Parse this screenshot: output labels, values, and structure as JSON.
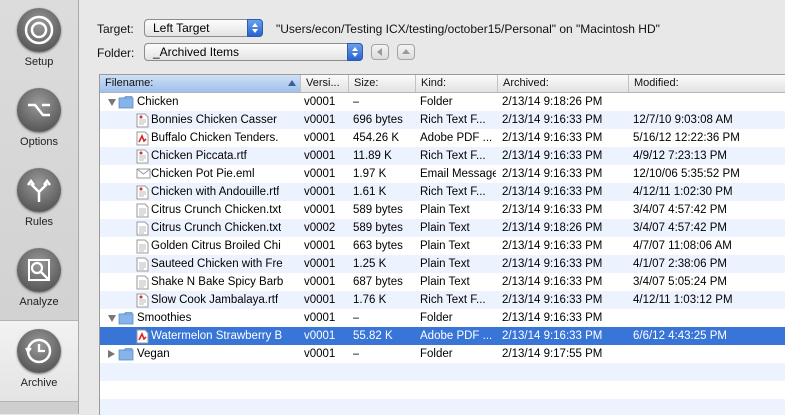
{
  "sidebar": {
    "items": [
      {
        "label": "Setup",
        "icon": "setup-icon"
      },
      {
        "label": "Options",
        "icon": "options-icon"
      },
      {
        "label": "Rules",
        "icon": "rules-icon"
      },
      {
        "label": "Analyze",
        "icon": "analyze-icon"
      },
      {
        "label": "Archive",
        "icon": "archive-icon",
        "selected": true
      }
    ]
  },
  "target": {
    "label": "Target:",
    "value": "Left Target",
    "path": "\"Users/econ/Testing ICX/testing/october15/Personal\" on \"Macintosh HD\""
  },
  "folder": {
    "label": "Folder:",
    "value": "_Archived Items"
  },
  "table": {
    "columns": [
      "Filename:",
      "Versi...",
      "Size:",
      "Kind:",
      "Archived:",
      "Modified:"
    ],
    "rows": [
      {
        "type": "folder",
        "open": true,
        "indent": 0,
        "name": "Chicken",
        "version": "v0001",
        "size": "–",
        "kind": "Folder",
        "archived": "2/13/14 9:18:26 PM",
        "modified": ""
      },
      {
        "type": "rtf",
        "indent": 1,
        "name": "Bonnies Chicken Casser",
        "version": "v0001",
        "size": "696 bytes",
        "kind": "Rich Text F...",
        "archived": "2/13/14 9:16:33 PM",
        "modified": "12/7/10 9:03:08 AM"
      },
      {
        "type": "pdf",
        "indent": 1,
        "name": "Buffalo Chicken Tenders.",
        "version": "v0001",
        "size": "454.26 K",
        "kind": "Adobe PDF ...",
        "archived": "2/13/14 9:16:33 PM",
        "modified": "5/16/12 12:22:36 PM"
      },
      {
        "type": "rtf",
        "indent": 1,
        "name": "Chicken Piccata.rtf",
        "version": "v0001",
        "size": "11.89 K",
        "kind": "Rich Text F...",
        "archived": "2/13/14 9:16:33 PM",
        "modified": "4/9/12 7:23:13 PM"
      },
      {
        "type": "eml",
        "indent": 1,
        "name": "Chicken Pot Pie.eml",
        "version": "v0001",
        "size": "1.97 K",
        "kind": "Email Message",
        "archived": "2/13/14 9:16:33 PM",
        "modified": "12/10/06 5:35:52 PM"
      },
      {
        "type": "rtf",
        "indent": 1,
        "name": "Chicken with Andouille.rtf",
        "version": "v0001",
        "size": "1.61 K",
        "kind": "Rich Text F...",
        "archived": "2/13/14 9:16:33 PM",
        "modified": "4/12/11 1:02:30 PM"
      },
      {
        "type": "txt",
        "indent": 1,
        "name": "Citrus Crunch Chicken.txt",
        "version": "v0001",
        "size": "589 bytes",
        "kind": "Plain Text",
        "archived": "2/13/14 9:16:33 PM",
        "modified": "3/4/07 4:57:42 PM"
      },
      {
        "type": "txt",
        "indent": 1,
        "name": "Citrus Crunch Chicken.txt",
        "version": "v0002",
        "size": "589 bytes",
        "kind": "Plain Text",
        "archived": "2/13/14 9:18:26 PM",
        "modified": "3/4/07 4:57:42 PM"
      },
      {
        "type": "txt",
        "indent": 1,
        "name": "Golden Citrus Broiled Chi",
        "version": "v0001",
        "size": "663 bytes",
        "kind": "Plain Text",
        "archived": "2/13/14 9:16:33 PM",
        "modified": "4/7/07 11:08:06 AM"
      },
      {
        "type": "txt",
        "indent": 1,
        "name": "Sauteed Chicken with Fre",
        "version": "v0001",
        "size": "1.25 K",
        "kind": "Plain Text",
        "archived": "2/13/14 9:16:33 PM",
        "modified": "4/1/07 2:38:06 PM"
      },
      {
        "type": "txt",
        "indent": 1,
        "name": "Shake N Bake Spicy Barb",
        "version": "v0001",
        "size": "687 bytes",
        "kind": "Plain Text",
        "archived": "2/13/14 9:16:33 PM",
        "modified": "3/4/07 5:05:24 PM"
      },
      {
        "type": "rtf",
        "indent": 1,
        "name": "Slow Cook Jambalaya.rtf",
        "version": "v0001",
        "size": "1.76 K",
        "kind": "Rich Text F...",
        "archived": "2/13/14 9:16:33 PM",
        "modified": "4/12/11 1:03:12 PM"
      },
      {
        "type": "folder",
        "open": true,
        "indent": 0,
        "name": "Smoothies",
        "version": "v0001",
        "size": "–",
        "kind": "Folder",
        "archived": "2/13/14 9:16:33 PM",
        "modified": ""
      },
      {
        "type": "pdf",
        "indent": 1,
        "selected": true,
        "name": "Watermelon Strawberry B",
        "version": "v0001",
        "size": "55.82 K",
        "kind": "Adobe PDF ...",
        "archived": "2/13/14 9:16:33 PM",
        "modified": "6/6/12 4:43:25 PM"
      },
      {
        "type": "folder",
        "open": false,
        "indent": 0,
        "name": "Vegan",
        "version": "v0001",
        "size": "–",
        "kind": "Folder",
        "archived": "2/13/14 9:17:55 PM",
        "modified": ""
      }
    ]
  },
  "colors": {
    "selection": "#3875d7",
    "alt_row": "#edf3fe",
    "folder": "#7fb0e6"
  }
}
